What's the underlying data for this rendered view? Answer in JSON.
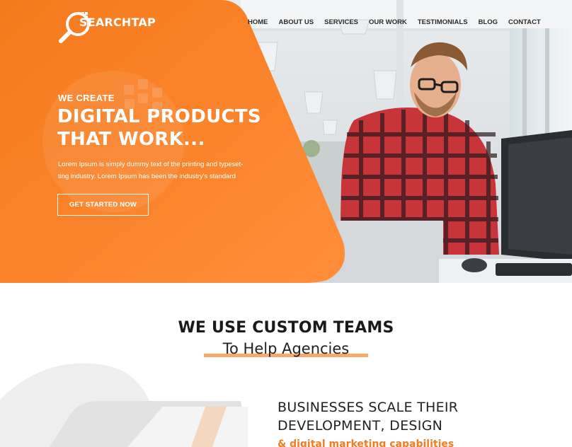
{
  "brand": {
    "name": "SEARCHTAP"
  },
  "nav": {
    "items": [
      "HOME",
      "ABOUT US",
      "SERVICES",
      "OUR WORK",
      "TESTIMONIALS",
      "BLOG",
      "CONTACT"
    ]
  },
  "hero": {
    "eyebrow": "WE CREATE",
    "headline_line1": "DIGITAL PRODUCTS",
    "headline_line2": "THAT WORK...",
    "text_line1": "Lorem Ipsum is simply dummy text of the printing and typeset-",
    "text_line2": "ting industry. Lorem Ipsum has been the industry's standard",
    "cta": "GET STARTED NOW"
  },
  "section": {
    "title": "WE USE CUSTOM TEAMS",
    "subtitle": "To Help Agencies",
    "business_line1": "BUSINESSES SCALE THEIR",
    "business_line2": "DEVELOPMENT, DESIGN",
    "business_line3": "& digital marketing capabilities"
  },
  "colors": {
    "accent": "#f47c20",
    "accent_light": "#f6a969",
    "text_dark": "#222222"
  },
  "icons": [
    "magnifier-logo-icon"
  ]
}
